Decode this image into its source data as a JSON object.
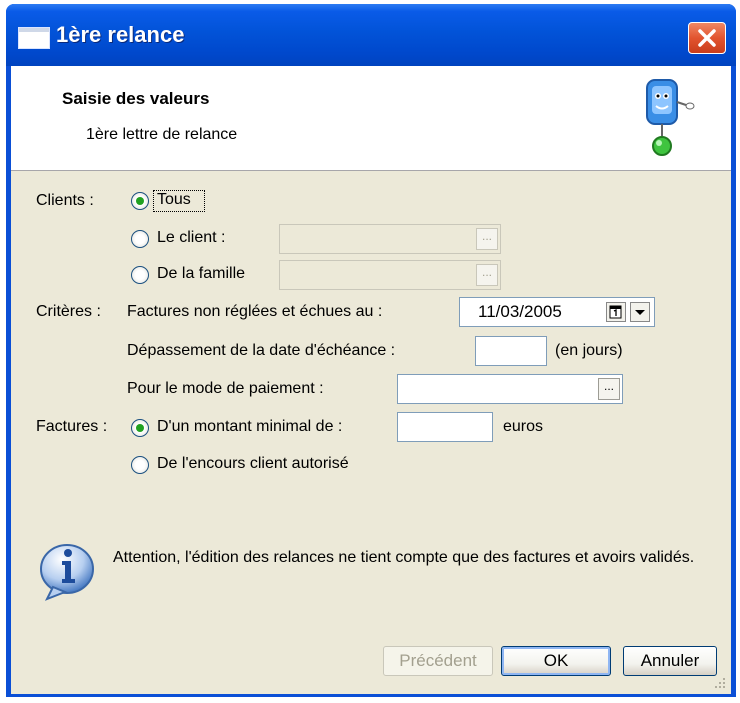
{
  "window": {
    "title": "1ère relance"
  },
  "header": {
    "title": "Saisie des valeurs",
    "subtitle": "1ère lettre de relance"
  },
  "clients": {
    "label": "Clients :",
    "options": [
      {
        "label": "Tous",
        "checked": true
      },
      {
        "label": "Le client :",
        "checked": false
      },
      {
        "label": "De la famille",
        "checked": false
      }
    ],
    "browse_label": "..."
  },
  "criteres": {
    "label": "Critères :",
    "due_label": "Factures non réglées et échues au :",
    "due_date": "11/03/2005",
    "overdue_label": "Dépassement de la date d'échéance :",
    "overdue_value": "",
    "overdue_unit": "(en jours)",
    "payment_label": "Pour le mode de paiement :",
    "payment_value": "",
    "browse_label": "..."
  },
  "factures": {
    "label": "Factures :",
    "options": [
      {
        "label": "D'un montant minimal de :",
        "checked": true
      },
      {
        "label": "De l'encours client autorisé",
        "checked": false
      }
    ],
    "amount_value": "",
    "amount_unit": "euros"
  },
  "info": {
    "text": "Attention, l'édition des relances ne tient compte que des factures et avoirs validés."
  },
  "buttons": {
    "previous": "Précédent",
    "ok": "OK",
    "cancel": "Annuler"
  },
  "colors": {
    "title_bar": "#0253d8",
    "dialog_bg": "#ece9d8",
    "close_button": "#e2542f",
    "radio_dot": "#21a121"
  }
}
